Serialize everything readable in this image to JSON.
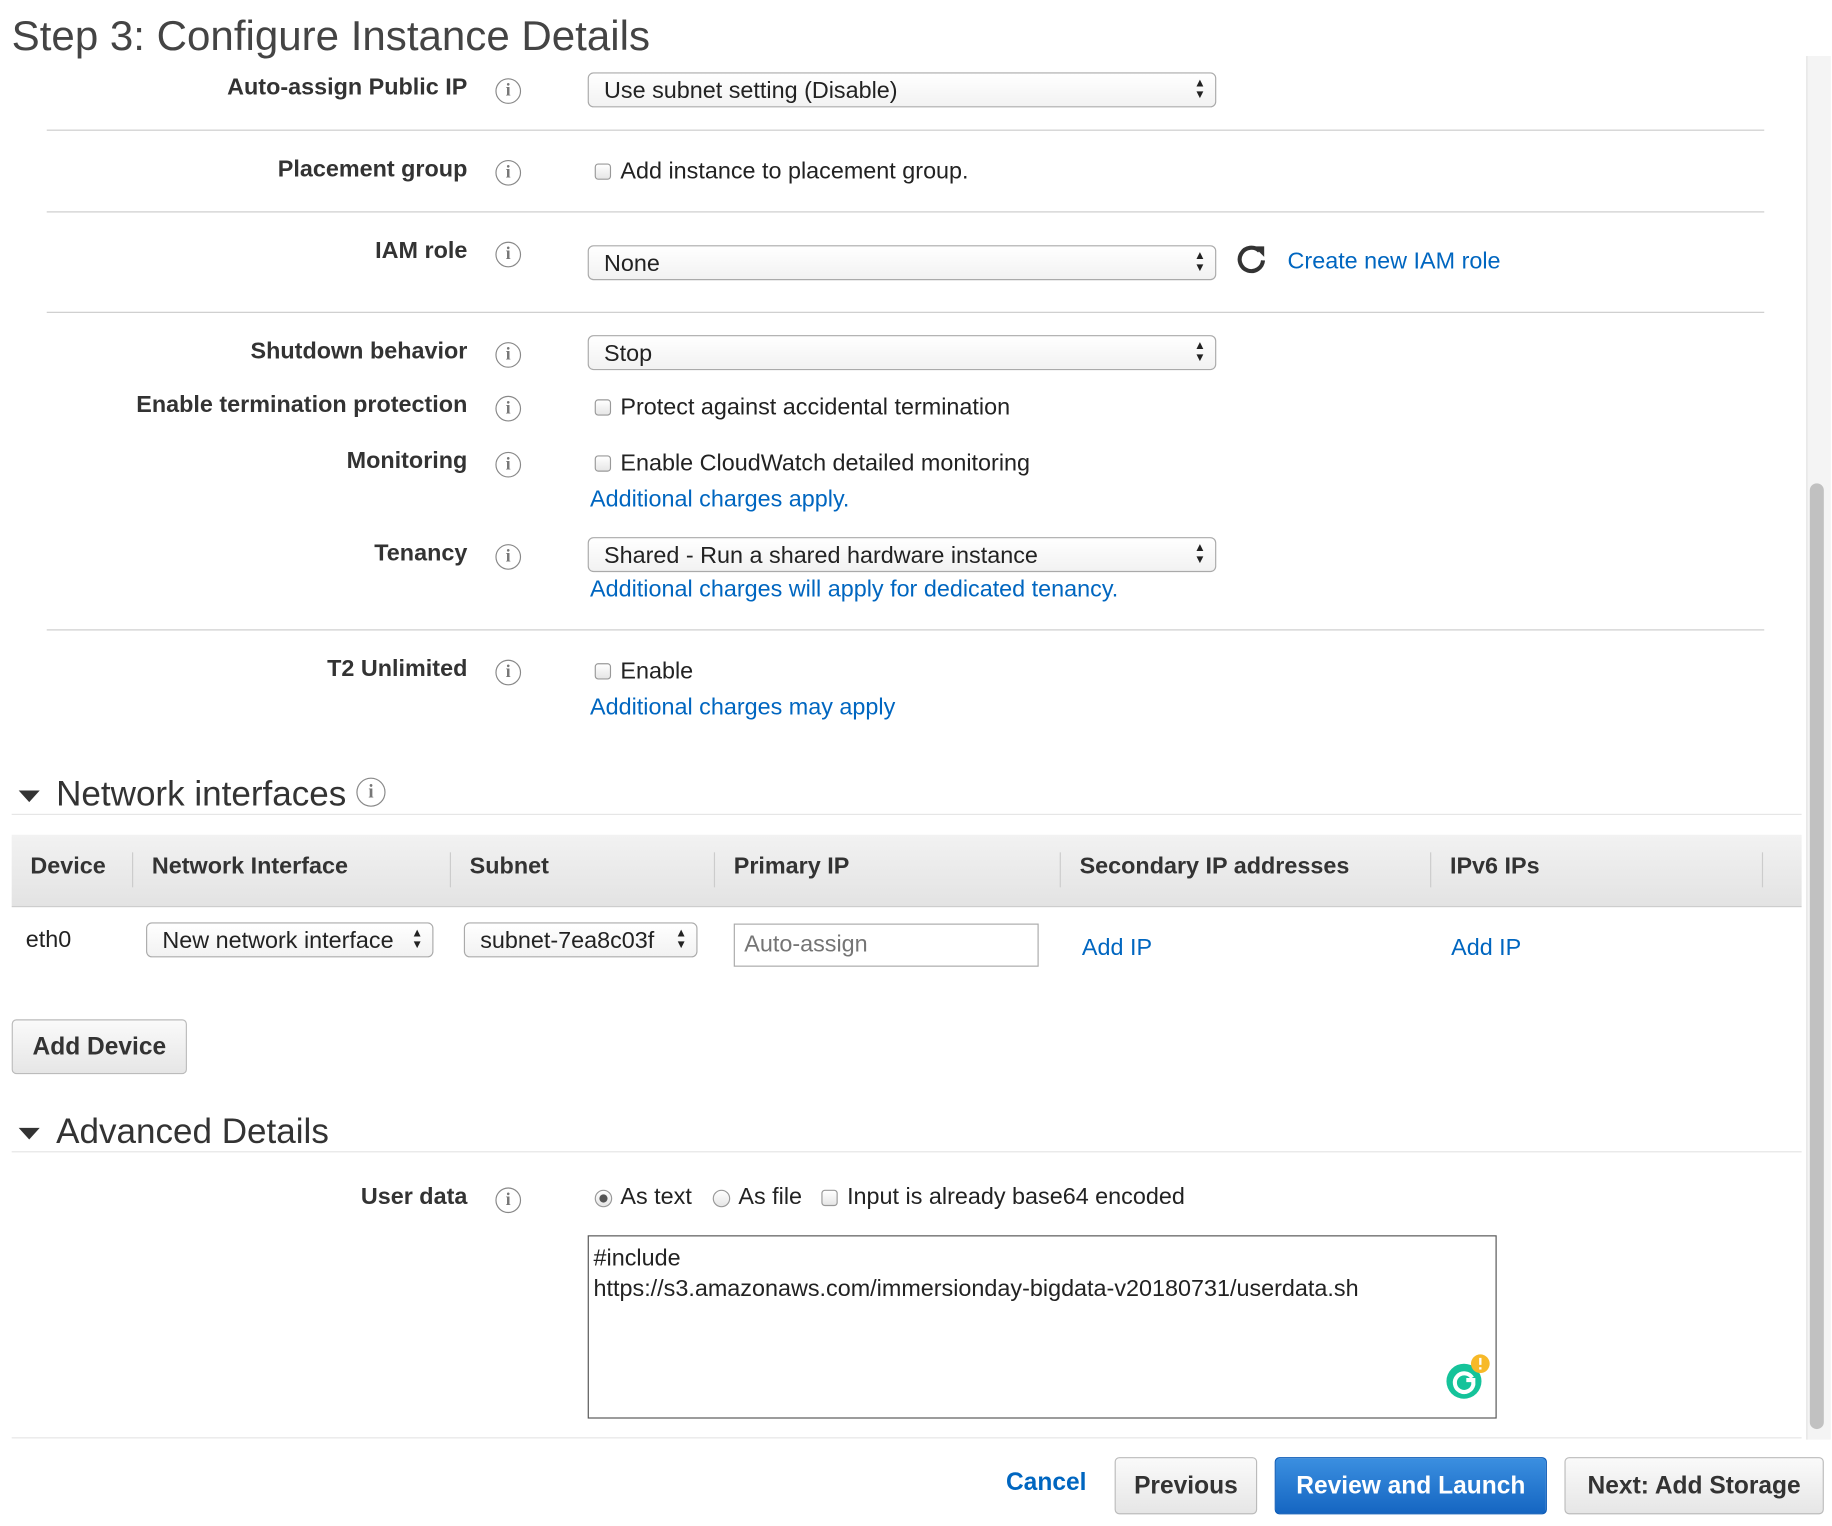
{
  "page": {
    "title": "Step 3: Configure Instance Details"
  },
  "fields": {
    "auto_assign_public_ip": {
      "label": "Auto-assign Public IP",
      "value": "Use subnet setting (Disable)"
    },
    "placement_group": {
      "label": "Placement group",
      "checkbox_label": "Add instance to placement group."
    },
    "iam_role": {
      "label": "IAM role",
      "value": "None",
      "create_link": "Create new IAM role"
    },
    "shutdown_behavior": {
      "label": "Shutdown behavior",
      "value": "Stop"
    },
    "termination_protection": {
      "label": "Enable termination protection",
      "checkbox_label": "Protect against accidental termination"
    },
    "monitoring": {
      "label": "Monitoring",
      "checkbox_label": "Enable CloudWatch detailed monitoring",
      "note": "Additional charges apply."
    },
    "tenancy": {
      "label": "Tenancy",
      "value": "Shared - Run a shared hardware instance",
      "note": "Additional charges will apply for dedicated tenancy."
    },
    "t2_unlimited": {
      "label": "T2 Unlimited",
      "checkbox_label": "Enable",
      "note": "Additional charges may apply"
    }
  },
  "network_interfaces": {
    "title": "Network interfaces",
    "columns": [
      "Device",
      "Network Interface",
      "Subnet",
      "Primary IP",
      "Secondary IP addresses",
      "IPv6 IPs"
    ],
    "row": {
      "device": "eth0",
      "network_interface": "New network interface",
      "subnet": "subnet-7ea8c03f",
      "primary_ip_placeholder": "Auto-assign",
      "secondary_ip_link": "Add IP",
      "ipv6_link": "Add IP"
    },
    "add_device_button": "Add Device"
  },
  "advanced": {
    "title": "Advanced Details",
    "user_data": {
      "label": "User data",
      "options": [
        "As text",
        "As file"
      ],
      "selected": "As text",
      "base64_label": "Input is already base64 encoded",
      "value": "#include\nhttps://s3.amazonaws.com/immersionday-bigdata-v20180731/userdata.sh"
    }
  },
  "footer": {
    "cancel": "Cancel",
    "previous": "Previous",
    "review_launch": "Review and Launch",
    "next": "Next: Add Storage"
  },
  "icons": {
    "info": "info-icon",
    "refresh": "refresh-icon",
    "grammarly": "grammarly-icon"
  },
  "colors": {
    "link": "#0066c0",
    "primary_button": "#1566c2"
  }
}
